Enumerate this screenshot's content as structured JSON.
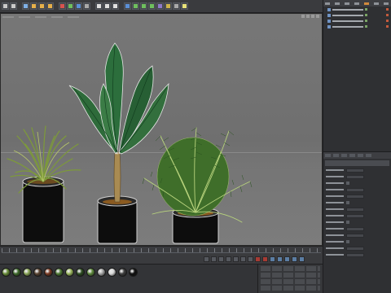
{
  "toolbar": {
    "buttons": [
      {
        "icon": "undo-icon",
        "color": "#c9c9c9"
      },
      {
        "icon": "redo-icon",
        "color": "#c9c9c9"
      },
      {
        "icon": "live-selection-icon",
        "color": "#7fb0e6"
      },
      {
        "icon": "move-icon",
        "color": "#e6b04a"
      },
      {
        "icon": "scale-icon",
        "color": "#e6b04a"
      },
      {
        "icon": "rotate-icon",
        "color": "#e6b04a"
      },
      {
        "icon": "x-axis-icon",
        "color": "#d9534f"
      },
      {
        "icon": "y-axis-icon",
        "color": "#6fbf5e"
      },
      {
        "icon": "z-axis-icon",
        "color": "#5b8fd6"
      },
      {
        "icon": "world-coords-icon",
        "color": "#a9a9a9"
      },
      {
        "icon": "render-view-icon",
        "color": "#e0e0e0"
      },
      {
        "icon": "render-icon",
        "color": "#e0e0e0"
      },
      {
        "icon": "render-settings-icon",
        "color": "#e0e0e0"
      },
      {
        "icon": "cube-icon",
        "color": "#5b8fd6"
      },
      {
        "icon": "pen-icon",
        "color": "#6fbf5e"
      },
      {
        "icon": "subdivision-icon",
        "color": "#6fbf5e"
      },
      {
        "icon": "array-icon",
        "color": "#6fbf5e"
      },
      {
        "icon": "deformer-icon",
        "color": "#8e79c9"
      },
      {
        "icon": "floor-icon",
        "color": "#cdb44a"
      },
      {
        "icon": "camera-icon",
        "color": "#a9a9a9"
      },
      {
        "icon": "light-icon",
        "color": "#e8e27a"
      }
    ]
  },
  "viewport": {
    "background": "#747474",
    "plants": [
      "grass-plant",
      "banana-plant",
      "palm-plant"
    ]
  },
  "timeline": {
    "transport": [
      "first-frame-icon",
      "prev-key-icon",
      "prev-frame-icon",
      "play-icon",
      "next-frame-icon",
      "next-key-icon",
      "last-frame-icon",
      "record-icon",
      "autokey-icon",
      "keyframe-icon",
      "motion-icon",
      "scale-key-icon",
      "param-key-icon",
      "pla-icon"
    ]
  },
  "materials": {
    "swatches": [
      "#6a8f3a",
      "#3f6b2c",
      "#8aa557",
      "#5a4432",
      "#7a3a22",
      "#4f7a34",
      "#9ab75c",
      "#2e4e22",
      "#5f8b3d",
      "#a3a3a3",
      "#d9d9d9",
      "#404040",
      "#111111"
    ]
  },
  "colors": {
    "accent": "#d18a3c",
    "panel": "#2f3033"
  }
}
